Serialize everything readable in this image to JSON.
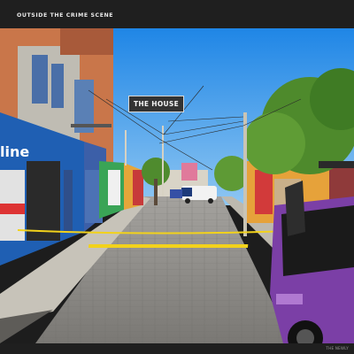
{
  "header": {
    "title": "OUTSIDE THE CRIME SCENE"
  },
  "labels": {
    "house": "THE HOUSE"
  },
  "storefront": {
    "sign_text": "line"
  },
  "footer": {
    "credit": "THE NEWLY"
  },
  "colors": {
    "sky": "#2a8fe8",
    "police_tape": "#f2d21b",
    "truck": "#7b3fa6",
    "road": "#8c8a86",
    "storefront_blue": "#1f5fb3"
  }
}
